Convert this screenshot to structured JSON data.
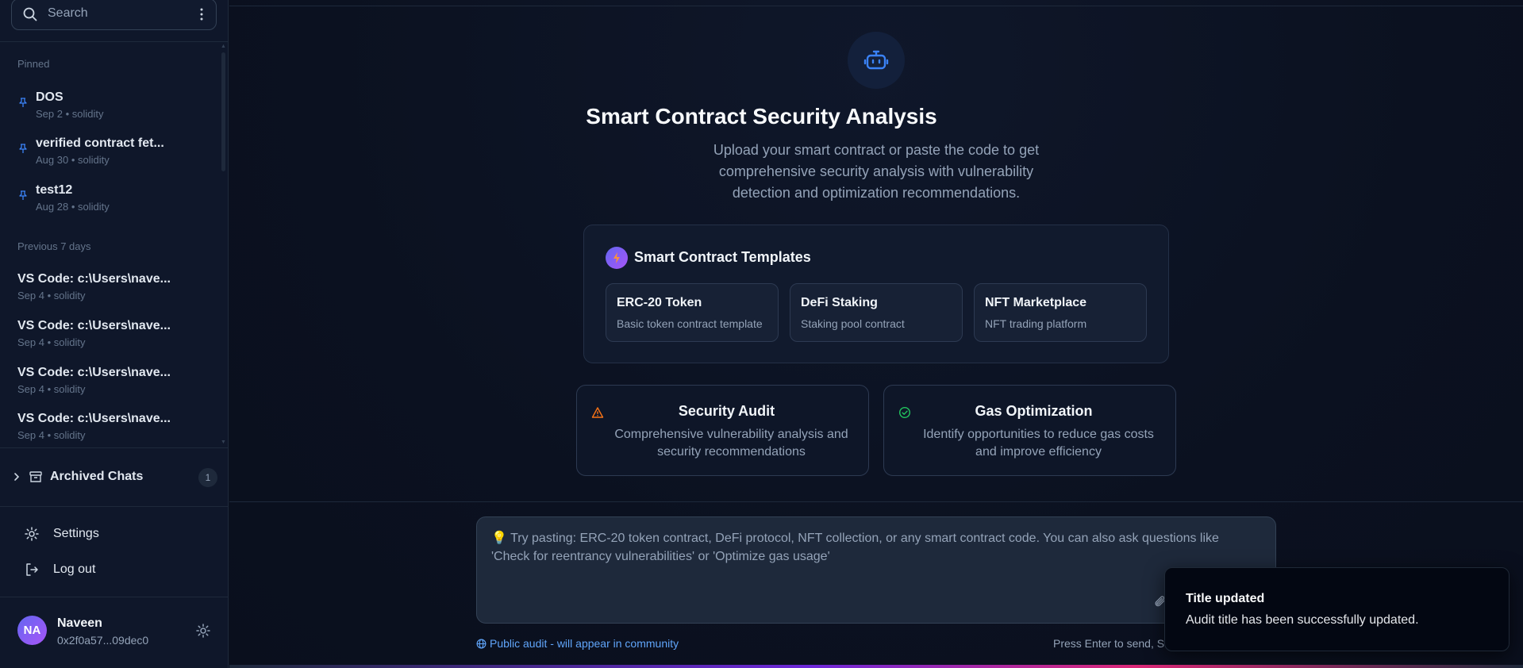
{
  "sidebar": {
    "search_placeholder": "Search",
    "sections": {
      "pinned": "Pinned",
      "previous": "Previous 7 days"
    },
    "pinned_items": [
      {
        "title": "DOS",
        "meta": "Sep 2 • solidity"
      },
      {
        "title": "verified contract fet...",
        "meta": "Aug 30 • solidity"
      },
      {
        "title": "test12",
        "meta": "Aug 28 • solidity"
      }
    ],
    "recent_items": [
      {
        "title": "VS Code: c:\\Users\\nave...",
        "meta": "Sep 4 • solidity"
      },
      {
        "title": "VS Code: c:\\Users\\nave...",
        "meta": "Sep 4 • solidity"
      },
      {
        "title": "VS Code: c:\\Users\\nave...",
        "meta": "Sep 4 • solidity"
      },
      {
        "title": "VS Code: c:\\Users\\nave...",
        "meta": "Sep 4 • solidity"
      }
    ],
    "archived": {
      "label": "Archived Chats",
      "count": "1"
    },
    "menu": {
      "settings": "Settings",
      "logout": "Log out"
    },
    "user": {
      "initials": "NA",
      "name": "Naveen",
      "address": "0x2f0a57...09dec0"
    }
  },
  "hero": {
    "title": "Smart Contract Security Analysis",
    "subtitle": "Upload your smart contract or paste the code to get comprehensive security analysis with vulnerability detection and optimization recommendations."
  },
  "templates": {
    "title": "Smart Contract Templates",
    "items": [
      {
        "name": "ERC-20 Token",
        "desc": "Basic token contract template"
      },
      {
        "name": "DeFi Staking",
        "desc": "Staking pool contract"
      },
      {
        "name": "NFT Marketplace",
        "desc": "NFT trading platform"
      }
    ]
  },
  "features": [
    {
      "title": "Security Audit",
      "desc": "Comprehensive vulnerability analysis and security recommendations",
      "icon": "warning-icon",
      "color": "#f97316"
    },
    {
      "title": "Gas Optimization",
      "desc": "Identify opportunities to reduce gas costs and improve efficiency",
      "icon": "check-circle-icon",
      "color": "#22c55e"
    }
  ],
  "composer": {
    "placeholder": "💡 Try pasting: ERC-20 token contract, DeFi protocol, NFT collection, or any smart contract code. You can also ask questions like 'Check for reentrancy vulnerabilities' or 'Optimize gas usage'",
    "public_note": "Public audit - will appear in community",
    "hint": "Press Enter to send, S"
  },
  "toast": {
    "title": "Title updated",
    "body": "Audit title has been successfully updated."
  },
  "colors": {
    "accent": "#3b82f6",
    "background": "#0b1120",
    "sidebar": "#0f172a"
  }
}
